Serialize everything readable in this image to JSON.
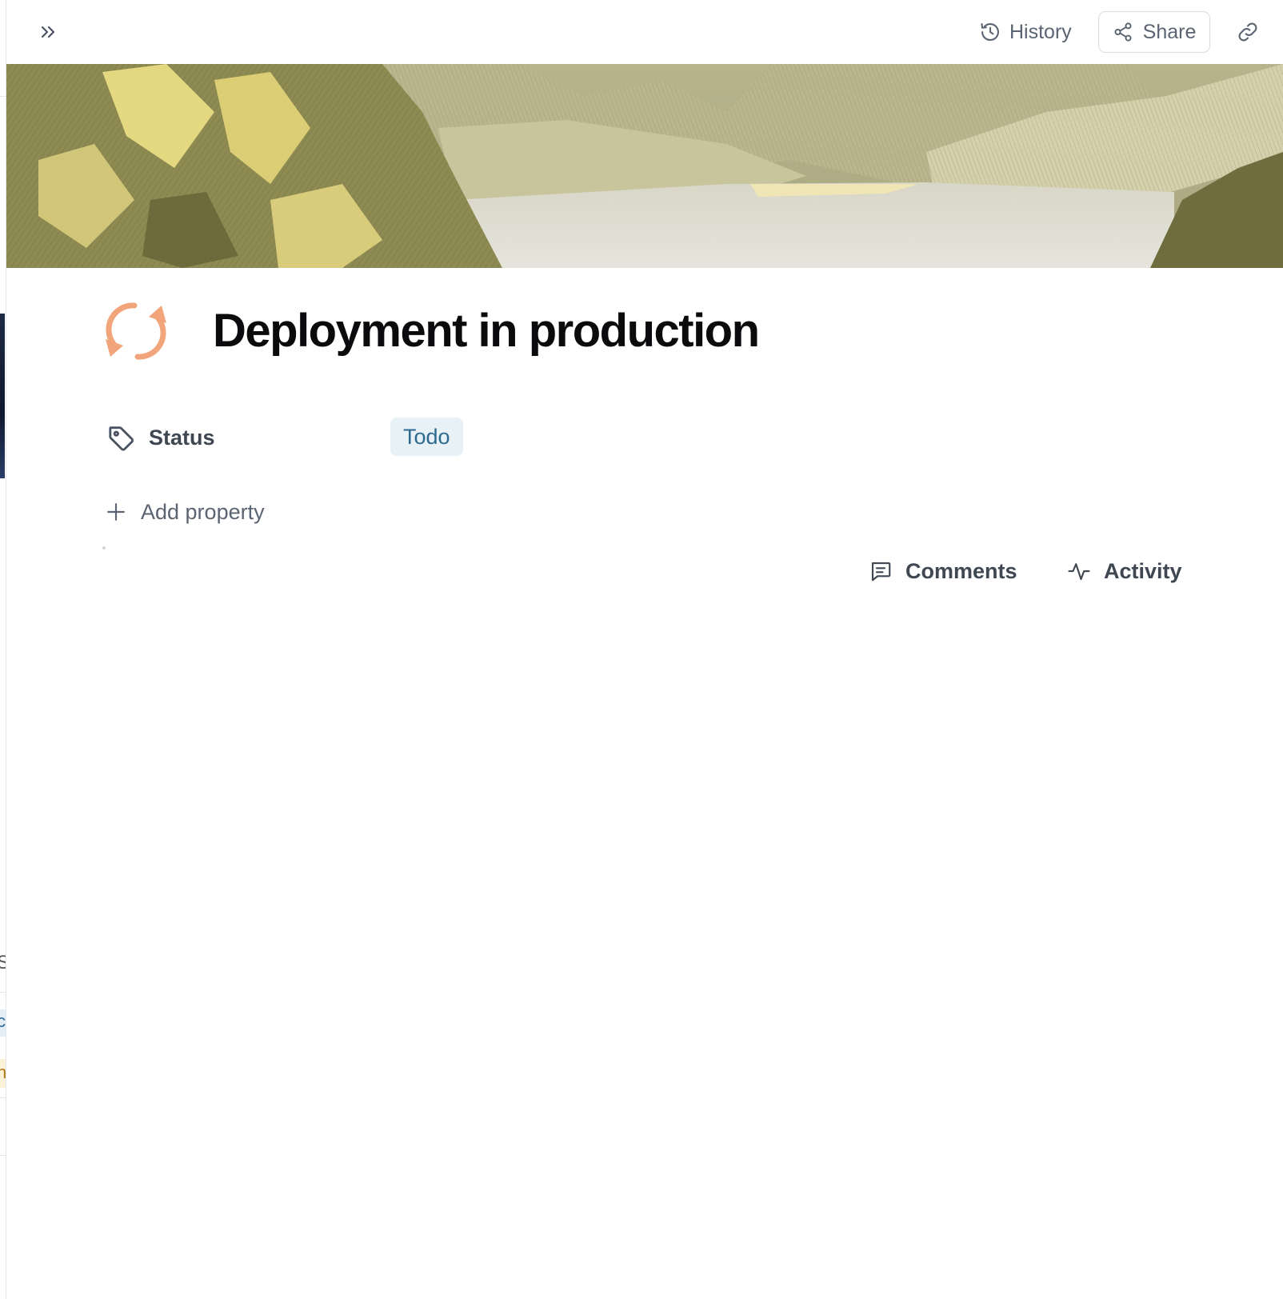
{
  "topbar": {
    "expand_icon": "double-chevron-right-icon",
    "history_label": "History",
    "share_label": "Share",
    "link_icon": "link-icon"
  },
  "page": {
    "icon": "refresh-icon",
    "icon_color": "#F2A47B",
    "title": "Deployment in production"
  },
  "properties": [
    {
      "icon": "tag-icon",
      "label": "Status",
      "value": "Todo"
    }
  ],
  "add_property_label": "Add property",
  "tabs": [
    {
      "icon": "comment-icon",
      "label": "Comments"
    },
    {
      "icon": "activity-icon",
      "label": "Activity"
    }
  ],
  "background_window": {
    "fragments": [
      "S",
      "c",
      "n"
    ]
  }
}
